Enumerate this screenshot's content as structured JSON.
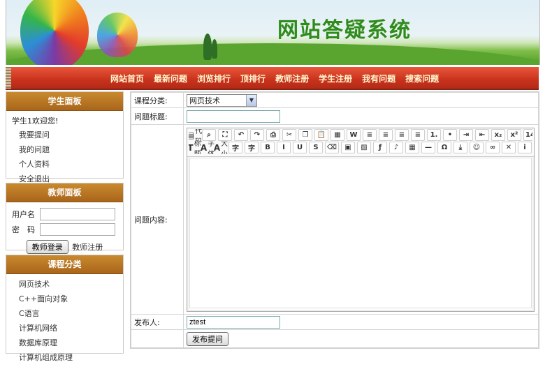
{
  "banner": {
    "title": "网站答疑系统"
  },
  "nav": [
    "网站首页",
    "最新问题",
    "浏览排行",
    "顶排行",
    "教师注册",
    "学生注册",
    "我有问题",
    "搜索问题"
  ],
  "student_panel": {
    "title": "学生面板",
    "welcome": "学生1欢迎您!",
    "links": [
      "我要提问",
      "我的问题",
      "个人资料",
      "安全退出"
    ]
  },
  "teacher_panel": {
    "title": "教师面板",
    "username_label": "用户名",
    "password_label": "密　码",
    "login_button": "教师登录",
    "register_link": "教师注册"
  },
  "category_panel": {
    "title": "课程分类",
    "items": [
      "网页技术",
      "C++面向对象",
      "C语言",
      "计算机网络",
      "数据库原理",
      "计算机组成原理"
    ]
  },
  "form": {
    "category_label": "课程分类:",
    "category_value": "网页技术",
    "title_label": "问题标题:",
    "title_value": "",
    "content_label": "问题内容:",
    "poster_label": "发布人:",
    "poster_value": "ztest",
    "submit_button": "发布提问"
  },
  "editor": {
    "row1": [
      {
        "icon": "code-icon",
        "label": "代码"
      },
      {
        "icon": "zoom-icon"
      },
      {
        "icon": "fullscreen-icon"
      },
      {
        "icon": "undo-icon"
      },
      {
        "icon": "redo-icon"
      },
      {
        "icon": "print-icon"
      },
      {
        "icon": "cut-icon"
      },
      {
        "icon": "copy-icon"
      },
      {
        "icon": "paste-icon"
      },
      {
        "icon": "paste-text-icon"
      },
      {
        "icon": "paste-word-icon"
      },
      {
        "icon": "align-left-icon"
      },
      {
        "icon": "align-center-icon"
      },
      {
        "icon": "align-right-icon"
      },
      {
        "icon": "justify-icon"
      },
      {
        "icon": "ordered-list-icon"
      },
      {
        "icon": "unordered-list-icon"
      },
      {
        "icon": "indent-icon"
      },
      {
        "icon": "outdent-icon"
      },
      {
        "icon": "subscript-icon"
      },
      {
        "icon": "superscript-icon"
      },
      {
        "icon": "date-icon"
      },
      {
        "icon": "time-icon"
      }
    ],
    "row2": [
      {
        "icon": "title-icon",
        "label": "标题"
      },
      {
        "icon": "font-icon",
        "label": "字体"
      },
      {
        "icon": "font-size-icon",
        "label": "大小"
      },
      {
        "icon": "text-color-icon"
      },
      {
        "icon": "bg-color-icon"
      },
      {
        "icon": "bold-icon"
      },
      {
        "icon": "italic-icon"
      },
      {
        "icon": "underline-icon"
      },
      {
        "icon": "strike-icon"
      },
      {
        "icon": "clear-format-icon"
      },
      {
        "icon": "select-all-icon"
      },
      {
        "icon": "image-icon"
      },
      {
        "icon": "flash-icon"
      },
      {
        "icon": "media-icon"
      },
      {
        "icon": "table-icon"
      },
      {
        "icon": "hr-icon"
      },
      {
        "icon": "special-char-icon"
      },
      {
        "icon": "page-break-icon"
      },
      {
        "icon": "emoticon-icon"
      },
      {
        "icon": "link-icon"
      },
      {
        "icon": "unlink-icon"
      },
      {
        "icon": "about-icon"
      }
    ]
  }
}
